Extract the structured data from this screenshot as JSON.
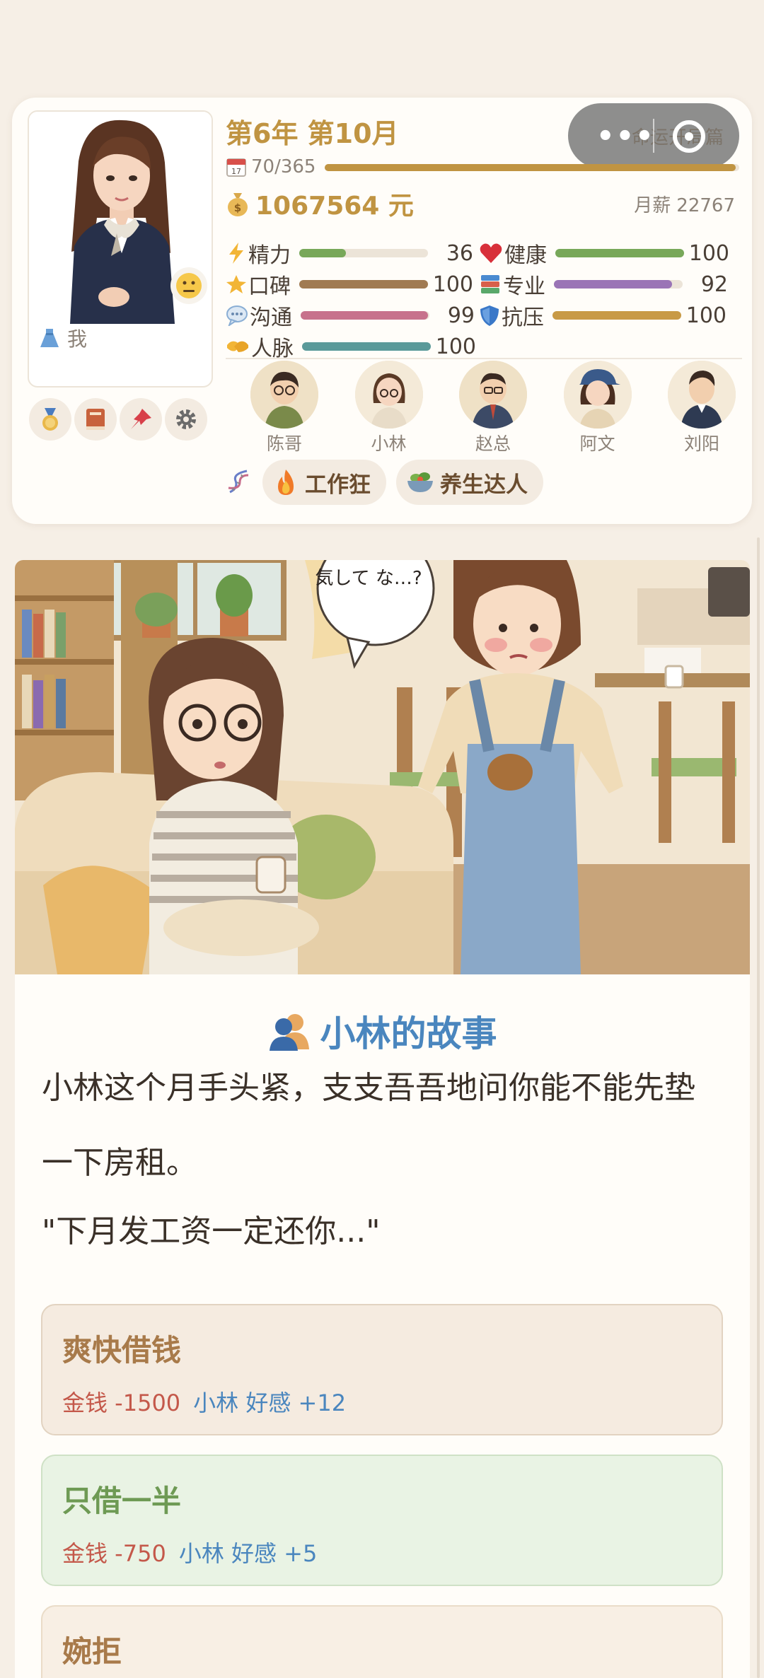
{
  "status": {
    "date_title": "第6年 第10月",
    "days_text": "70/365",
    "days_progress": 0.992,
    "money": "1067564 元",
    "salary_label": "月薪",
    "salary_value": "22767",
    "player_name": "我",
    "capsule_text": "命运开局篇",
    "stats": [
      {
        "label": "精力",
        "value": "36",
        "level": 0.36,
        "color": "#78a85a",
        "icon": "lightning-icon"
      },
      {
        "label": "健康",
        "value": "100",
        "level": 1.0,
        "color": "#78a85a",
        "icon": "heart-icon"
      },
      {
        "label": "口碑",
        "value": "100",
        "level": 1.0,
        "color": "#a07a52",
        "icon": "star-icon"
      },
      {
        "label": "专业",
        "value": "92",
        "level": 0.92,
        "color": "#9a74b6",
        "icon": "books-icon"
      },
      {
        "label": "沟通",
        "value": "99",
        "level": 0.99,
        "color": "#c7728c",
        "icon": "speech-bubble-icon"
      },
      {
        "label": "抗压",
        "value": "100",
        "level": 1.0,
        "color": "#c89a46",
        "icon": "shield-icon"
      },
      {
        "label": "人脉",
        "value": "100",
        "level": 1.0,
        "color": "#5a9a9a",
        "icon": "handshake-icon"
      }
    ],
    "npcs": [
      {
        "name": "陈哥"
      },
      {
        "name": "小林"
      },
      {
        "name": "赵总"
      },
      {
        "name": "阿文"
      },
      {
        "name": "刘阳"
      }
    ],
    "traits": [
      {
        "label": "工作狂",
        "icon": "fire-icon"
      },
      {
        "label": "养生达人",
        "icon": "salad-icon"
      }
    ],
    "tools": [
      "medal-icon",
      "book-icon",
      "pin-icon",
      "gear-icon"
    ]
  },
  "story": {
    "title": "小林的故事",
    "paragraph1": "小林这个月手头紧，支支吾吾地问你能不能先垫一下房租。",
    "paragraph2": "\"下月发工资一定还你...\"",
    "illustration_bubble": "気して な…?",
    "choices": [
      {
        "title": "爽快借钱",
        "money": "金钱 -1500",
        "relation": "小林 好感 +12",
        "bg": "#f5ebe0",
        "border": "#e2d3c1",
        "title_color": "#a87a4a"
      },
      {
        "title": "只借一半",
        "money": "金钱 -750",
        "relation": "小林 好感 +5",
        "bg": "#e9f3e4",
        "border": "#cfe1c6",
        "title_color": "#6e9a54"
      },
      {
        "title": "婉拒",
        "money": "",
        "relation": "",
        "bg": "#f8efe4",
        "border": "#eadcc8",
        "title_color": "#a87a4a"
      }
    ]
  }
}
